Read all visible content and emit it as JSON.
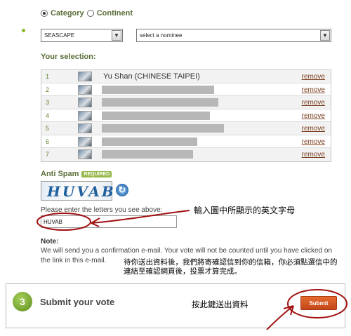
{
  "filter": {
    "option_category": "Category",
    "option_continent": "Continent",
    "selected": "Category"
  },
  "selects": {
    "category_value": "SEASCAPE",
    "nominee_value": "select a nominee"
  },
  "selection": {
    "heading": "Your selection:",
    "remove_label": "remove",
    "rows": [
      {
        "num": "1",
        "name": "Yu Shan (CHINESE TAIPEI)"
      },
      {
        "num": "2",
        "name": ""
      },
      {
        "num": "3",
        "name": ""
      },
      {
        "num": "4",
        "name": ""
      },
      {
        "num": "5",
        "name": ""
      },
      {
        "num": "6",
        "name": ""
      },
      {
        "num": "7",
        "name": ""
      }
    ]
  },
  "antispam": {
    "label": "Anti Spam",
    "badge": "REQUIRED",
    "captcha_text": "HUVAB",
    "prompt": "Please enter the letters you see above:",
    "input_value": "HUVAB"
  },
  "note": {
    "title": "Note:",
    "text": "We will send you a confirmation e-mail. Your vote will not be counted until you have clicked on the link in this e-mail."
  },
  "annotations": {
    "enter_captcha": "輸入圖中所顯示的英文字母",
    "confirm_email": "待你送出資料後，我們將寄確認信到你的信箱，你必須點選信中的連結至確認網頁後，投票才算完成。",
    "press_submit": "按此鍵送出資料"
  },
  "submit": {
    "step_number": "3",
    "title": "Submit your vote",
    "button_label": "Submit"
  },
  "colors": {
    "accent_green": "#8bb82b",
    "heading_green": "#5b6f3a",
    "submit_orange": "#d4561f",
    "annotation_red": "#a01010"
  }
}
